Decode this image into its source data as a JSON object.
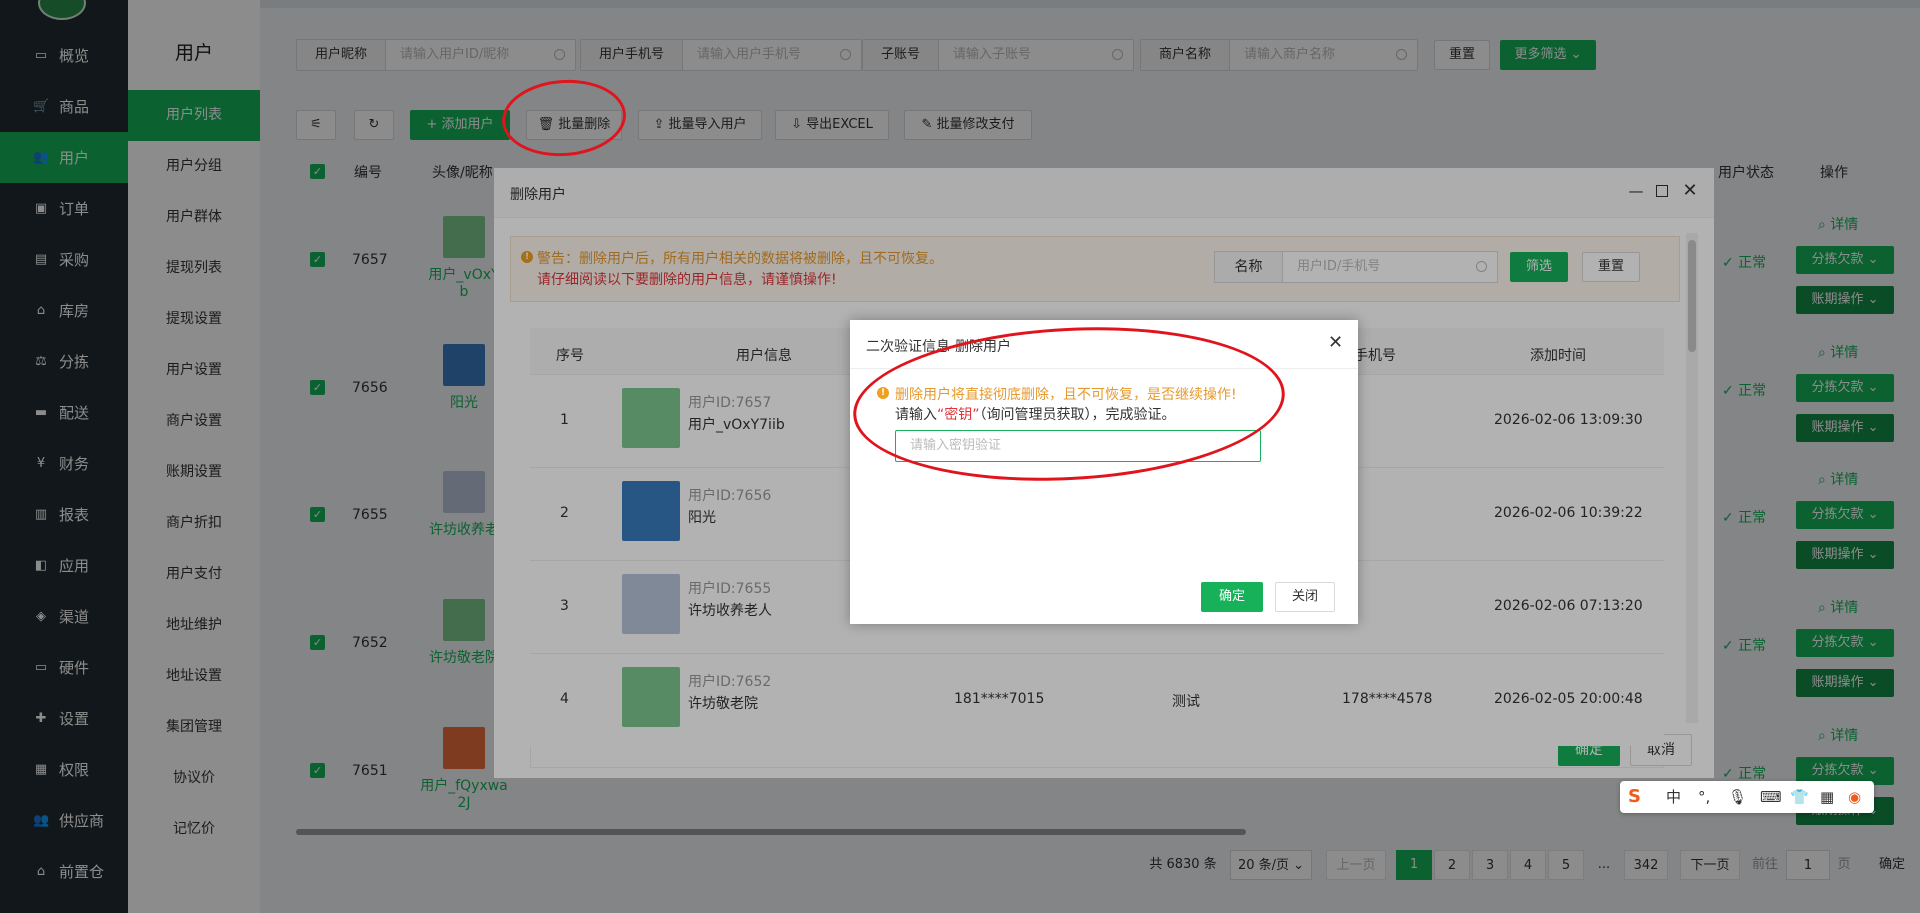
{
  "sidebar": {
    "items": [
      {
        "label": "概览",
        "icon": "monitor-icon",
        "glyph": "▭"
      },
      {
        "label": "商品",
        "icon": "cart-icon",
        "glyph": "🛒"
      },
      {
        "label": "用户",
        "icon": "users-icon",
        "glyph": "👥",
        "active": true
      },
      {
        "label": "订单",
        "icon": "order-icon",
        "glyph": "▣"
      },
      {
        "label": "采购",
        "icon": "bus-icon",
        "glyph": "▤"
      },
      {
        "label": "库房",
        "icon": "home-icon",
        "glyph": "⌂"
      },
      {
        "label": "分拣",
        "icon": "scale-icon",
        "glyph": "⚖"
      },
      {
        "label": "配送",
        "icon": "truck-icon",
        "glyph": "▬"
      },
      {
        "label": "财务",
        "icon": "yen-icon",
        "glyph": "¥"
      },
      {
        "label": "报表",
        "icon": "bar-chart-icon",
        "glyph": "▥"
      },
      {
        "label": "应用",
        "icon": "apps-icon",
        "glyph": "◧"
      },
      {
        "label": "渠道",
        "icon": "cube-icon",
        "glyph": "◈"
      },
      {
        "label": "硬件",
        "icon": "desktop-icon",
        "glyph": "▭"
      },
      {
        "label": "设置",
        "icon": "puzzle-icon",
        "glyph": "✚"
      },
      {
        "label": "权限",
        "icon": "bank-icon",
        "glyph": "▦"
      },
      {
        "label": "供应商",
        "icon": "supplier-icon",
        "glyph": "👥"
      },
      {
        "label": "前置仓",
        "icon": "warehouse-icon",
        "glyph": "⌂"
      }
    ]
  },
  "submenu": {
    "title": "用户",
    "items": [
      "用户列表",
      "用户分组",
      "用户群体",
      "提现列表",
      "提现设置",
      "用户设置",
      "商户设置",
      "账期设置",
      "商户折扣",
      "用户支付",
      "地址维护",
      "地址设置",
      "集团管理",
      "协议价",
      "记忆价"
    ]
  },
  "filters": [
    {
      "label": "用户昵称",
      "placeholder": "请输入用户ID/昵称"
    },
    {
      "label": "用户手机号",
      "placeholder": "请输入用户手机号"
    },
    {
      "label": "子账号",
      "placeholder": "请输入子账号"
    },
    {
      "label": "商户名称",
      "placeholder": "请输入商户名称"
    }
  ],
  "filter_reset": "重置",
  "filter_more": "更多筛选 ⌄",
  "toolbar": {
    "add": "+ 添加用户",
    "batch_delete": "🗑 批量删除",
    "batch_import": "⇪ 批量导入用户",
    "export": "⇩ 导出EXCEL",
    "batch_pay": "✎ 批量修改支付"
  },
  "table": {
    "headers": {
      "id": "编号",
      "avatar": "头像/昵称",
      "status": "用户状态",
      "ops": "操作"
    },
    "rows": [
      {
        "id": "7657",
        "name1": "用户_vOxY",
        "name2": "b",
        "status": "✓ 正常"
      },
      {
        "id": "7656",
        "name1": "阳光",
        "name2": "",
        "status": "✓ 正常"
      },
      {
        "id": "7655",
        "name1": "许坊收养老",
        "name2": "",
        "status": "✓ 正常"
      },
      {
        "id": "7652",
        "name1": "许坊敬老院",
        "name2": "",
        "status": "✓ 正常"
      },
      {
        "id": "7651",
        "name1": "用户_fQyxwa",
        "name2": "2J",
        "status": "✓ 正常"
      }
    ],
    "op_detail": "详情",
    "op_debt": "分拣欠款 ⌄",
    "op_period": "账期操作 ⌄"
  },
  "pager": {
    "total": "共 6830 条",
    "size": "20 条/页",
    "prev": "上一页",
    "pages": [
      "1",
      "2",
      "3",
      "4",
      "5",
      "...",
      "342"
    ],
    "next": "下一页",
    "goto": "前往",
    "page_value": "1",
    "page_unit": "页",
    "confirm": "确定"
  },
  "dialog1": {
    "title": "删除用户",
    "warn1": "警告：删除用户后，所有用户相关的数据将被删除，且不可恢复。",
    "warn2": "请仔细阅读以下要删除的用户信息，请谨慎操作!",
    "name_label": "名称",
    "name_placeholder": "用户ID/手机号",
    "filter_btn": "筛选",
    "reset_btn": "重置",
    "headers": {
      "seq": "序号",
      "info": "用户信息",
      "phone": "手机号",
      "time": "添加时间"
    },
    "rows": [
      {
        "seq": "1",
        "uid": "用户ID:7657",
        "name": "用户_vOxY7iib",
        "phone": "",
        "remark": "",
        "sub": "",
        "time": "2026-02-06 13:09:30"
      },
      {
        "seq": "2",
        "uid": "用户ID:7656",
        "name": "阳光",
        "phone": "",
        "remark": "",
        "sub": "",
        "time": "2026-02-06 10:39:22"
      },
      {
        "seq": "3",
        "uid": "用户ID:7655",
        "name": "许坊收养老人",
        "phone": "",
        "remark": "",
        "sub": "",
        "time": "2026-02-06 07:13:20"
      },
      {
        "seq": "4",
        "uid": "用户ID:7652",
        "name": "许坊敬老院",
        "phone": "181****7015",
        "remark": "测试",
        "sub": "178****4578",
        "time": "2026-02-05 20:00:48"
      }
    ],
    "ok": "确定",
    "cancel": "取消"
  },
  "dialog2": {
    "title": "二次验证信息-删除用户",
    "warn": "删除用户将直接彻底删除，且不可恢复，是否继续操作!",
    "inst_pre": "请输入",
    "inst_key": "“密钥”",
    "inst_post": "（询问管理员获取），完成验证。",
    "placeholder": "请输入密钥验证",
    "ok": "确定",
    "close": "关闭"
  },
  "ime": {
    "zh": "中"
  },
  "colors": {
    "brand": "#17b15a",
    "sidebar": "#1f2a30",
    "annotation": "#e0141c",
    "warning": "#e69a2e",
    "danger": "#e0353b"
  }
}
